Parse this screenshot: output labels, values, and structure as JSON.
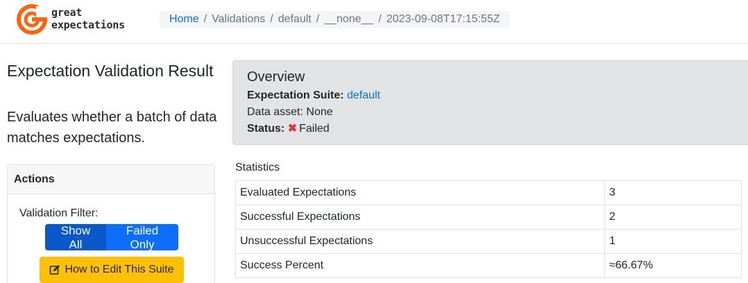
{
  "logo": {
    "line1": "great",
    "line2": "expectations",
    "accent": "#ff6310"
  },
  "breadcrumb": {
    "home": "Home",
    "validations": "Validations",
    "suite": "default",
    "run": "__none__",
    "timestamp": "2023-09-08T17:15:55Z"
  },
  "page": {
    "title": "Expectation Validation Result",
    "description": "Evaluates whether a batch of data matches expectations."
  },
  "actions": {
    "header": "Actions",
    "filter_label": "Validation Filter:",
    "show_all": "Show All",
    "failed_only": "Failed Only",
    "edit_suite": "How to Edit This Suite",
    "edit_icon": "edit-icon"
  },
  "overview": {
    "title": "Overview",
    "suite_label": "Expectation Suite:",
    "suite_value": "default",
    "asset_label": "Data asset:",
    "asset_value": "None",
    "status_label": "Status:",
    "status_icon": "✖",
    "status_value": "Failed",
    "status_color": "#dc3545"
  },
  "statistics": {
    "title": "Statistics",
    "rows": [
      {
        "label": "Evaluated Expectations",
        "value": "3"
      },
      {
        "label": "Successful Expectations",
        "value": "2"
      },
      {
        "label": "Unsuccessful Expectations",
        "value": "1"
      },
      {
        "label": "Success Percent",
        "value": "≈66.67%"
      }
    ]
  }
}
